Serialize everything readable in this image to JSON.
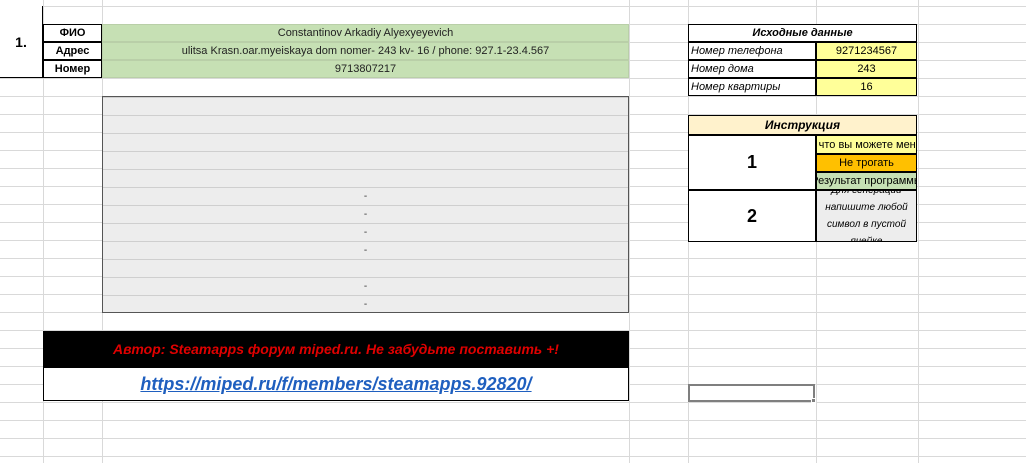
{
  "record": {
    "number": "1.",
    "rows": [
      {
        "label": "ФИО",
        "value": "Constantinov Arkadiy Alyexyeyevich"
      },
      {
        "label": "Адрес",
        "value": "ulitsa Krasn.oar.myeiskaya dom nomer- 243 kv-  16 / phone: 927.1-23.4.567"
      },
      {
        "label": "Номер",
        "value": "9713807217"
      }
    ],
    "results": [
      "",
      "",
      "",
      "",
      "",
      "-",
      "-",
      "-",
      "-",
      "",
      "-",
      "-"
    ]
  },
  "banner": {
    "text": "Автор: Steamapps форум miped.ru. Не забудьте поставить +!",
    "link": "https://miped.ru/f/members/steamapps.92820/"
  },
  "source": {
    "title": "Исходные данные",
    "rows": [
      {
        "label": "Номер телефона",
        "value": "9271234567"
      },
      {
        "label": "Номер дома",
        "value": "243"
      },
      {
        "label": "Номер квартиры",
        "value": "16"
      }
    ]
  },
  "instruction": {
    "title": "Инструкция",
    "step1_number": "1",
    "step1_items": [
      {
        "text": "То, что вы можете менять",
        "color": "#ffff99"
      },
      {
        "text": "Не трогать",
        "color": "#ffc000"
      },
      {
        "text": "Результат программы",
        "color": "#c6e0b4"
      }
    ],
    "step2_number": "2",
    "step2_text": "Для генерации напишите любой символ в пустой ячейке"
  }
}
